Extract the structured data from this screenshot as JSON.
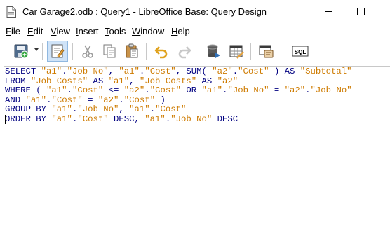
{
  "window": {
    "title": "Car Garage2.odb : Query1 - LibreOffice Base: Query Design"
  },
  "menu": [
    {
      "label_u": "F",
      "label_rest": "ile"
    },
    {
      "label_u": "E",
      "label_rest": "dit"
    },
    {
      "label_u": "V",
      "label_rest": "iew"
    },
    {
      "label_u": "I",
      "label_rest": "nsert"
    },
    {
      "label_u": "T",
      "label_rest": "ools"
    },
    {
      "label_u": "W",
      "label_rest": "indow"
    },
    {
      "label_u": "H",
      "label_rest": "elp"
    }
  ],
  "toolbar": {
    "buttons": [
      "save-icon",
      "edit-icon",
      "cut-icon",
      "copy-icon",
      "paste-icon",
      "undo-icon",
      "redo-icon",
      "run-query-icon",
      "clear-query-icon",
      "design-view-icon",
      "run-sql-directly-icon"
    ],
    "sql_label": "SQL"
  },
  "colors": {
    "keyword": "#000080",
    "string": "#ce7b00"
  },
  "sql": {
    "lines": [
      [
        {
          "t": "kw",
          "v": "SELECT "
        },
        {
          "t": "str",
          "v": "\"a1\""
        },
        {
          "t": "kw",
          "v": "."
        },
        {
          "t": "str",
          "v": "\"Job No\""
        },
        {
          "t": "kw",
          "v": ", "
        },
        {
          "t": "str",
          "v": "\"a1\""
        },
        {
          "t": "kw",
          "v": "."
        },
        {
          "t": "str",
          "v": "\"Cost\""
        },
        {
          "t": "kw",
          "v": ", SUM( "
        },
        {
          "t": "str",
          "v": "\"a2\""
        },
        {
          "t": "kw",
          "v": "."
        },
        {
          "t": "str",
          "v": "\"Cost\""
        },
        {
          "t": "kw",
          "v": " ) AS "
        },
        {
          "t": "str",
          "v": "\"Subtotal\""
        }
      ],
      [
        {
          "t": "kw",
          "v": "FROM "
        },
        {
          "t": "str",
          "v": "\"Job Costs\""
        },
        {
          "t": "kw",
          "v": " AS "
        },
        {
          "t": "str",
          "v": "\"a1\""
        },
        {
          "t": "kw",
          "v": ", "
        },
        {
          "t": "str",
          "v": "\"Job Costs\""
        },
        {
          "t": "kw",
          "v": " AS "
        },
        {
          "t": "str",
          "v": "\"a2\""
        }
      ],
      [
        {
          "t": "kw",
          "v": "WHERE ( "
        },
        {
          "t": "str",
          "v": "\"a1\""
        },
        {
          "t": "kw",
          "v": "."
        },
        {
          "t": "str",
          "v": "\"Cost\""
        },
        {
          "t": "kw",
          "v": " <= "
        },
        {
          "t": "str",
          "v": "\"a2\""
        },
        {
          "t": "kw",
          "v": "."
        },
        {
          "t": "str",
          "v": "\"Cost\""
        },
        {
          "t": "kw",
          "v": " OR "
        },
        {
          "t": "str",
          "v": "\"a1\""
        },
        {
          "t": "kw",
          "v": "."
        },
        {
          "t": "str",
          "v": "\"Job No\""
        },
        {
          "t": "kw",
          "v": " = "
        },
        {
          "t": "str",
          "v": "\"a2\""
        },
        {
          "t": "kw",
          "v": "."
        },
        {
          "t": "str",
          "v": "\"Job No\""
        }
      ],
      [
        {
          "t": "kw",
          "v": "AND "
        },
        {
          "t": "str",
          "v": "\"a1\""
        },
        {
          "t": "kw",
          "v": "."
        },
        {
          "t": "str",
          "v": "\"Cost\""
        },
        {
          "t": "kw",
          "v": " = "
        },
        {
          "t": "str",
          "v": "\"a2\""
        },
        {
          "t": "kw",
          "v": "."
        },
        {
          "t": "str",
          "v": "\"Cost\""
        },
        {
          "t": "kw",
          "v": " )"
        }
      ],
      [
        {
          "t": "kw",
          "v": "GROUP BY "
        },
        {
          "t": "str",
          "v": "\"a1\""
        },
        {
          "t": "kw",
          "v": "."
        },
        {
          "t": "str",
          "v": "\"Job No\""
        },
        {
          "t": "kw",
          "v": ", "
        },
        {
          "t": "str",
          "v": "\"a1\""
        },
        {
          "t": "kw",
          "v": "."
        },
        {
          "t": "str",
          "v": "\"Cost\""
        }
      ],
      [
        {
          "t": "kw",
          "v": "ORDER BY "
        },
        {
          "t": "str",
          "v": "\"a1\""
        },
        {
          "t": "kw",
          "v": "."
        },
        {
          "t": "str",
          "v": "\"Cost\""
        },
        {
          "t": "kw",
          "v": " DESC, "
        },
        {
          "t": "str",
          "v": "\"a1\""
        },
        {
          "t": "kw",
          "v": "."
        },
        {
          "t": "str",
          "v": "\"Job No\""
        },
        {
          "t": "kw",
          "v": " DESC"
        }
      ]
    ]
  }
}
